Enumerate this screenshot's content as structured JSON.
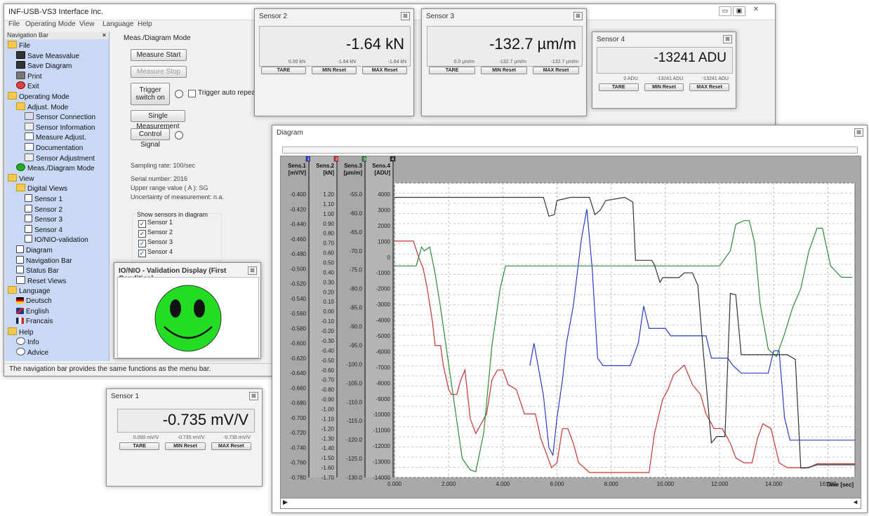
{
  "main_window": {
    "title": "INF-USB-VS3 Interface Inc.",
    "menu": [
      "File",
      "Operating Mode",
      "View",
      "Language",
      "Help"
    ],
    "nav_title": "Navigation Bar",
    "nav_close": "×",
    "nav_items": [
      {
        "label": "File",
        "icon": "folder-icon",
        "level": 0
      },
      {
        "label": "Save Measvalue",
        "icon": "save-icon",
        "level": 1
      },
      {
        "label": "Save Diagram",
        "icon": "save-icon",
        "level": 1
      },
      {
        "label": "Print",
        "icon": "print-icon",
        "level": 1
      },
      {
        "label": "Exit",
        "icon": "exit-icon",
        "level": 1
      },
      {
        "label": "Operating Mode",
        "icon": "folder-icon",
        "level": 0
      },
      {
        "label": "Adjust. Mode",
        "icon": "folder-icon",
        "level": 1
      },
      {
        "label": "Sensor Connection",
        "icon": "connection-icon",
        "level": 2
      },
      {
        "label": "Sensor Information",
        "icon": "sensor-icon",
        "level": 2
      },
      {
        "label": "Measure Adjust.",
        "icon": "adjust-icon",
        "level": 2
      },
      {
        "label": "Documentation",
        "icon": "document-icon",
        "level": 2
      },
      {
        "label": "Sensor Adjustment",
        "icon": "sensor-icon",
        "level": 2
      },
      {
        "label": "Meas./Diagram Mode",
        "icon": "play-icon",
        "level": 1
      },
      {
        "label": "View",
        "icon": "folder-icon",
        "level": 0
      },
      {
        "label": "Digital Views",
        "icon": "folder-icon",
        "level": 1
      },
      {
        "label": "Sensor 1",
        "icon": "checkbox-icon",
        "level": 2
      },
      {
        "label": "Sensor 2",
        "icon": "checkbox-icon",
        "level": 2
      },
      {
        "label": "Sensor 3",
        "icon": "checkbox-icon",
        "level": 2
      },
      {
        "label": "Sensor 4",
        "icon": "checkbox-icon",
        "level": 2
      },
      {
        "label": "IO/NIO-validation",
        "icon": "checkbox-icon",
        "level": 2
      },
      {
        "label": "Diagram",
        "icon": "checkbox-icon",
        "level": 1
      },
      {
        "label": "Navigation Bar",
        "icon": "checkbox-icon",
        "level": 1
      },
      {
        "label": "Status Bar",
        "icon": "checkbox-icon",
        "level": 1
      },
      {
        "label": "Reset Views",
        "icon": "reset-icon",
        "level": 1
      },
      {
        "label": "Language",
        "icon": "folder-icon",
        "level": 0
      },
      {
        "label": "Deutsch",
        "icon": "flag-de-icon",
        "level": 1
      },
      {
        "label": "English",
        "icon": "flag-uk-icon",
        "level": 1
      },
      {
        "label": "Francais",
        "icon": "flag-fr-icon",
        "level": 1
      },
      {
        "label": "Help",
        "icon": "folder-icon",
        "level": 0
      },
      {
        "label": "Info",
        "icon": "info-icon",
        "level": 1
      },
      {
        "label": "Advice",
        "icon": "advice-icon",
        "level": 1
      }
    ],
    "panel_title": "Meas./Diagram Mode",
    "measure_start": "Measure Start",
    "measure_stop": "Measure Stop",
    "trigger_line1": "Trigger",
    "trigger_line2": "switch on",
    "trigger_auto": "Trigger auto repeat",
    "single_measurement": "Single Measurement",
    "control_signal": "Control Signal",
    "sampling_rate": "Sampling rate: 100/sec",
    "serial_number": "Serial number: 2016",
    "upper_range": "Upper range value ( A ): SG",
    "uncertainty": "Uncertainty of measurement: n.a.",
    "show_sensors_title": "Show sensors in diagram",
    "show_sensors": [
      "Sensor 1",
      "Sensor 2",
      "Sensor 3",
      "Sensor 4"
    ],
    "status": "The navigation bar provides the same functions as the menu bar."
  },
  "sensors": [
    {
      "title": "Sensor 1",
      "value": "-0.735 mV/V",
      "zero": "0.000 mV/V",
      "min": "-0.735 mV/V",
      "max": "-0.735 mV/V"
    },
    {
      "title": "Sensor 2",
      "value": "-1.64 kN",
      "zero": "0.00 kN",
      "min": "-1.64 kN",
      "max": "-1.64 kN"
    },
    {
      "title": "Sensor 3",
      "value": "-132.7 µm/m",
      "zero": "0.0 µm/m",
      "min": "-132.7 µm/m",
      "max": "-132.7 µm/m"
    },
    {
      "title": "Sensor 4",
      "value": "-13241 ADU",
      "zero": "0 ADU",
      "min": "-13241 ADU",
      "max": "-13241 ADU"
    }
  ],
  "sensor_buttons": {
    "tare": "TARE",
    "min_reset": "MIN Reset",
    "max_reset": "MAX Reset"
  },
  "validation": {
    "title": "IO/NIO - Validation Display (First Condition)",
    "face_color": "#22dd22"
  },
  "diagram": {
    "title": "Diagram",
    "close": "⊠",
    "scroll_left": "◄",
    "scroll_right": "▶"
  },
  "chart_data": {
    "type": "line",
    "xlabel": "Time [sec]",
    "xlim": [
      0,
      17000
    ],
    "x_ticks": [
      "0.000",
      "2.000",
      "4.000",
      "6.000",
      "8.000",
      "10.000",
      "12.000",
      "14.000",
      "16.000"
    ],
    "axes": [
      {
        "name": "Sens.1",
        "unit": "[mV/V]",
        "index": "1",
        "color": "#2a3cc8",
        "ticks": [
          "-0.400",
          "-0.420",
          "-0.440",
          "-0.460",
          "-0.480",
          "-0.500",
          "-0.520",
          "-0.540",
          "-0.560",
          "-0.580",
          "-0.600",
          "-0.620",
          "-0.640",
          "-0.660",
          "-0.680",
          "-0.700",
          "-0.720",
          "-0.740",
          "-0.760",
          "-0.780"
        ]
      },
      {
        "name": "Sens.2",
        "unit": "[kN]",
        "index": "2",
        "color": "#c83232",
        "ticks": [
          "1.20",
          "1.10",
          "1.00",
          "0.90",
          "0.80",
          "0.70",
          "0.60",
          "0.50",
          "0.40",
          "0.30",
          "0.20",
          "0.10",
          "0.00",
          "-0.10",
          "-0.20",
          "-0.30",
          "-0.40",
          "-0.50",
          "-0.60",
          "-0.70",
          "-0.80",
          "-0.90",
          "-1.00",
          "-1.10",
          "-1.20",
          "-1.30",
          "-1.40",
          "-1.50",
          "-1.60",
          "-1.70"
        ]
      },
      {
        "name": "Sens.3",
        "unit": "[µm/m]",
        "index": "3",
        "color": "#2e8b3c",
        "ticks": [
          "-55.0",
          "-60.0",
          "-65.0",
          "-70.0",
          "-75.0",
          "-80.0",
          "-85.0",
          "-90.0",
          "-95.0",
          "-100.0",
          "-105.0",
          "-110.0",
          "-115.0",
          "-120.0",
          "-125.0",
          "-130.0"
        ]
      },
      {
        "name": "Sens.4",
        "unit": "[ADU]",
        "index": "4",
        "color": "#333333",
        "ticks": [
          "4000",
          "3000",
          "2000",
          "1000",
          "0",
          "-1000",
          "-2000",
          "-3000",
          "-4000",
          "-5000",
          "-6000",
          "-7000",
          "-8000",
          "-9000",
          "-10000",
          "-11000",
          "-12000",
          "-13000",
          "-14000"
        ]
      }
    ],
    "series": [
      {
        "name": "Sens.2",
        "color": "#c83232",
        "ylim": [
          -1.7,
          1.2
        ],
        "points": [
          [
            0,
            0.72
          ],
          [
            700,
            0.72
          ],
          [
            900,
            0.55
          ],
          [
            1050,
            0.45
          ],
          [
            1200,
            0.25
          ],
          [
            1400,
            -0.1
          ],
          [
            1500,
            -0.35
          ],
          [
            1700,
            -0.35
          ],
          [
            1800,
            -0.55
          ],
          [
            2000,
            -0.8
          ],
          [
            2100,
            -0.85
          ],
          [
            2300,
            -0.85
          ],
          [
            2450,
            -0.7
          ],
          [
            2600,
            -0.6
          ],
          [
            2800,
            -1.1
          ],
          [
            3000,
            -1.25
          ],
          [
            3200,
            -1.15
          ],
          [
            3400,
            -1.05
          ],
          [
            3600,
            -0.7
          ],
          [
            3800,
            -0.6
          ],
          [
            4000,
            -0.6
          ],
          [
            4200,
            -0.75
          ],
          [
            4500,
            -0.8
          ],
          [
            4800,
            -1.05
          ],
          [
            5200,
            -1.05
          ],
          [
            5400,
            -1.3
          ],
          [
            5600,
            -1.45
          ],
          [
            5800,
            -1.6
          ],
          [
            6000,
            -1.55
          ],
          [
            6200,
            -1.2
          ],
          [
            6400,
            -1.2
          ],
          [
            6600,
            -1.35
          ],
          [
            6800,
            -1.55
          ],
          [
            7000,
            -1.6
          ],
          [
            7200,
            -1.65
          ],
          [
            9400,
            -1.65
          ],
          [
            9600,
            -1.25
          ],
          [
            9900,
            -0.9
          ],
          [
            10100,
            -0.8
          ],
          [
            10300,
            -0.65
          ],
          [
            10500,
            -0.6
          ],
          [
            10700,
            -0.55
          ],
          [
            11000,
            -0.75
          ],
          [
            11300,
            -0.85
          ],
          [
            11500,
            -1.05
          ],
          [
            11800,
            -1.2
          ],
          [
            12100,
            -1.2
          ],
          [
            12400,
            -1.35
          ],
          [
            12600,
            -1.5
          ],
          [
            12900,
            -1.55
          ],
          [
            13200,
            -1.55
          ],
          [
            13400,
            -1.3
          ],
          [
            13600,
            -1.15
          ],
          [
            13900,
            -1.2
          ],
          [
            14200,
            -1.55
          ],
          [
            14500,
            -1.6
          ],
          [
            15300,
            -1.6
          ],
          [
            15600,
            -1.56
          ],
          [
            16000,
            -1.56
          ],
          [
            17000,
            -1.56
          ]
        ]
      },
      {
        "name": "Sens.1",
        "color": "#2a3cc8",
        "ylim": [
          -0.78,
          -0.4
        ],
        "points": [
          [
            5000,
            -0.63
          ],
          [
            5150,
            -0.6
          ],
          [
            5300,
            -0.63
          ],
          [
            5500,
            -0.67
          ],
          [
            5700,
            -0.74
          ],
          [
            5850,
            -0.75
          ],
          [
            6000,
            -0.7
          ],
          [
            6200,
            -0.65
          ],
          [
            6350,
            -0.6
          ],
          [
            6600,
            -0.55
          ],
          [
            6900,
            -0.46
          ],
          [
            7100,
            -0.42
          ],
          [
            7300,
            -0.5
          ],
          [
            7500,
            -0.62
          ],
          [
            7700,
            -0.63
          ],
          [
            8700,
            -0.63
          ],
          [
            9000,
            -0.6
          ],
          [
            9200,
            -0.55
          ],
          [
            9400,
            -0.58
          ],
          [
            9700,
            -0.58
          ],
          [
            10000,
            -0.58
          ],
          [
            10200,
            -0.59
          ],
          [
            11500,
            -0.59
          ],
          [
            11700,
            -0.62
          ],
          [
            12000,
            -0.62
          ],
          [
            12300,
            -0.62
          ],
          [
            12500,
            -0.63
          ],
          [
            12800,
            -0.64
          ],
          [
            13800,
            -0.64
          ],
          [
            14000,
            -0.61
          ],
          [
            14200,
            -0.61
          ],
          [
            14400,
            -0.7
          ],
          [
            14600,
            -0.73
          ],
          [
            15000,
            -0.73
          ],
          [
            15500,
            -0.73
          ],
          [
            16500,
            -0.73
          ],
          [
            17000,
            -0.73
          ]
        ]
      },
      {
        "name": "Sens.3",
        "color": "#2e8b3c",
        "ylim": [
          -130,
          -55
        ],
        "points": [
          [
            0,
            -74
          ],
          [
            800,
            -74
          ],
          [
            1000,
            -69
          ],
          [
            1100,
            -70
          ],
          [
            1300,
            -69
          ],
          [
            1500,
            -76
          ],
          [
            1700,
            -85
          ],
          [
            1900,
            -95
          ],
          [
            2100,
            -105
          ],
          [
            2300,
            -115
          ],
          [
            2500,
            -125
          ],
          [
            2800,
            -128
          ],
          [
            3000,
            -128.5
          ],
          [
            3300,
            -118
          ],
          [
            3600,
            -95
          ],
          [
            3900,
            -80
          ],
          [
            4100,
            -74
          ],
          [
            4300,
            -74
          ],
          [
            10500,
            -74
          ],
          [
            11200,
            -74
          ],
          [
            12000,
            -74
          ],
          [
            12400,
            -70
          ],
          [
            12600,
            -63
          ],
          [
            12900,
            -62
          ],
          [
            13100,
            -62
          ],
          [
            13300,
            -68
          ],
          [
            13500,
            -84
          ],
          [
            13800,
            -96
          ],
          [
            14100,
            -98
          ],
          [
            14400,
            -92
          ],
          [
            14700,
            -85
          ],
          [
            15000,
            -80
          ],
          [
            15300,
            -70
          ],
          [
            15600,
            -64
          ],
          [
            15800,
            -64
          ],
          [
            16100,
            -74
          ],
          [
            16500,
            -77
          ],
          [
            16900,
            -77
          ]
        ]
      },
      {
        "name": "Sens.4",
        "color": "#333333",
        "ylim": [
          -14000,
          4000
        ],
        "points": [
          [
            0,
            3800
          ],
          [
            5500,
            3800
          ],
          [
            5700,
            2600
          ],
          [
            5900,
            2700
          ],
          [
            6000,
            3600
          ],
          [
            6500,
            3800
          ],
          [
            7200,
            3800
          ],
          [
            7400,
            2700
          ],
          [
            7600,
            3000
          ],
          [
            7800,
            3600
          ],
          [
            8500,
            3800
          ],
          [
            8800,
            3500
          ],
          [
            8900,
            -200
          ],
          [
            9500,
            -200
          ],
          [
            9600,
            -500
          ],
          [
            9800,
            -1600
          ],
          [
            9900,
            -1300
          ],
          [
            10500,
            -1300
          ],
          [
            10700,
            -1000
          ],
          [
            11000,
            -1000
          ],
          [
            11200,
            -1800
          ],
          [
            11400,
            -6000
          ],
          [
            11700,
            -11800
          ],
          [
            11900,
            -11400
          ],
          [
            12200,
            -11400
          ],
          [
            12400,
            -2300
          ],
          [
            12600,
            -2400
          ],
          [
            12800,
            -6200
          ],
          [
            14000,
            -6200
          ],
          [
            14500,
            -6200
          ],
          [
            14800,
            -6500
          ],
          [
            15000,
            -13400
          ],
          [
            15200,
            -13400
          ],
          [
            15600,
            -13200
          ],
          [
            16000,
            -13200
          ],
          [
            16500,
            -13200
          ],
          [
            17000,
            -13200
          ]
        ]
      }
    ]
  }
}
